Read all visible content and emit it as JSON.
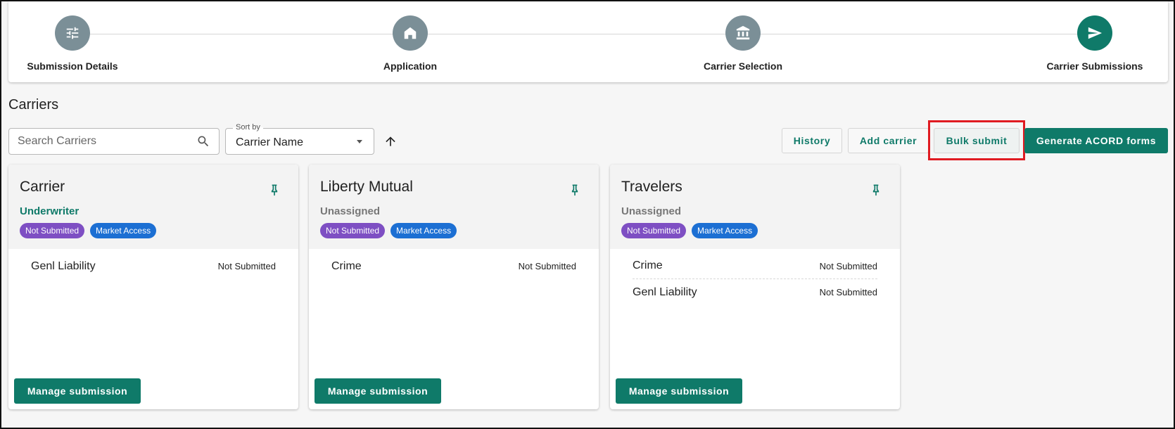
{
  "stepper": {
    "steps": [
      {
        "label": "Submission Details",
        "icon": "sliders-icon",
        "active": false
      },
      {
        "label": "Application",
        "icon": "home-icon",
        "active": false
      },
      {
        "label": "Carrier Selection",
        "icon": "bank-icon",
        "active": false
      },
      {
        "label": "Carrier Submissions",
        "icon": "send-icon",
        "active": true
      }
    ]
  },
  "page_title": "Carriers",
  "toolbar": {
    "search_placeholder": "Search Carriers",
    "sort_legend": "Sort by",
    "sort_value": "Carrier Name",
    "history_label": "History",
    "add_carrier_label": "Add carrier",
    "bulk_submit_label": "Bulk submit",
    "generate_label": "Generate ACORD forms"
  },
  "colors": {
    "accent": "#0f7a69",
    "status_badge": "#7e4fc3",
    "market_badge": "#1c6fd3",
    "highlight": "#e01b22"
  },
  "cards": [
    {
      "title": "Carrier",
      "subtitle": "Underwriter",
      "badges": [
        "Not Submitted",
        "Market Access"
      ],
      "lines": [
        {
          "name": "Genl Liability",
          "status": "Not Submitted"
        }
      ],
      "button": "Manage submission"
    },
    {
      "title": "Liberty Mutual",
      "subtitle": "Unassigned",
      "badges": [
        "Not Submitted",
        "Market Access"
      ],
      "lines": [
        {
          "name": "Crime",
          "status": "Not Submitted"
        }
      ],
      "button": "Manage submission"
    },
    {
      "title": "Travelers",
      "subtitle": "Unassigned",
      "badges": [
        "Not Submitted",
        "Market Access"
      ],
      "lines": [
        {
          "name": "Crime",
          "status": "Not Submitted"
        },
        {
          "name": "Genl Liability",
          "status": "Not Submitted"
        }
      ],
      "button": "Manage submission"
    }
  ]
}
